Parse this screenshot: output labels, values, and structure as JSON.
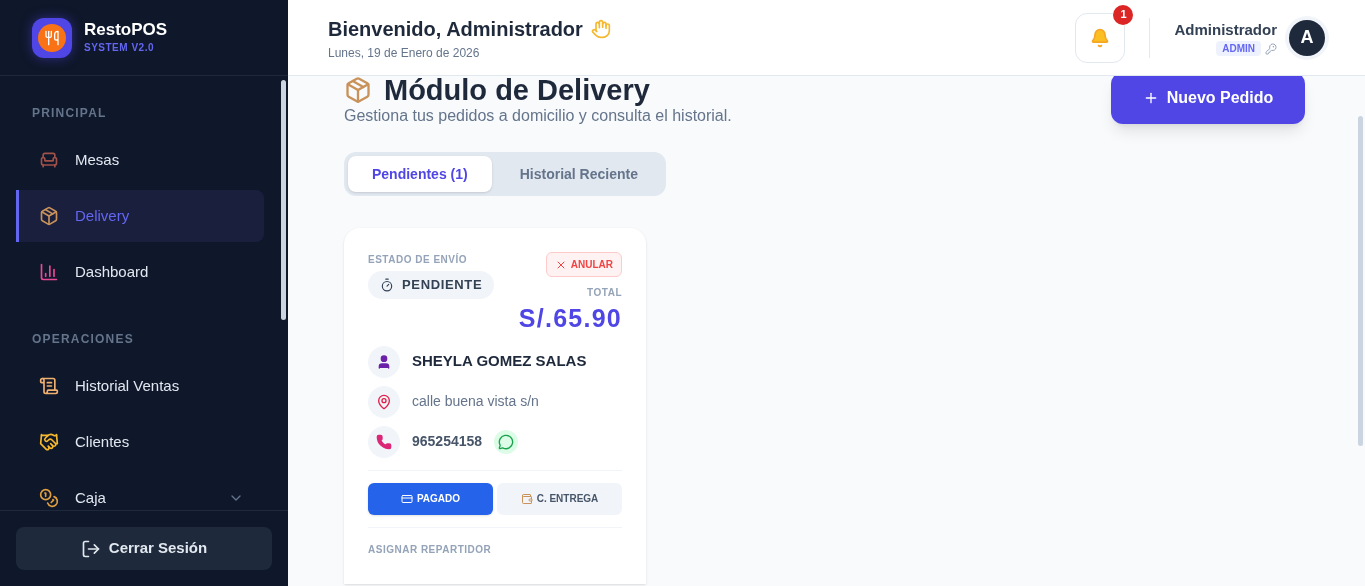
{
  "brand": {
    "name": "RestoPOS",
    "version": "SYSTEM V2.0"
  },
  "sidebar": {
    "sections": [
      {
        "title": "PRINCIPAL",
        "items": [
          {
            "label": "Mesas",
            "kind": "chair",
            "selected": false
          },
          {
            "label": "Delivery",
            "kind": "package",
            "selected": true
          },
          {
            "label": "Dashboard",
            "kind": "chart",
            "selected": false
          }
        ]
      },
      {
        "title": "OPERACIONES",
        "items": [
          {
            "label": "Historial Ventas",
            "kind": "scroll",
            "selected": false
          },
          {
            "label": "Clientes",
            "kind": "handshake",
            "selected": false
          },
          {
            "label": "Caja",
            "kind": "money",
            "selected": false,
            "expandable": true
          }
        ]
      }
    ],
    "logout": "Cerrar Sesión"
  },
  "header": {
    "greeting": "Bienvenido, Administrador",
    "date": "Lunes, 19 de Enero de 2026",
    "notifications": "1",
    "user": {
      "name": "Administrador",
      "role": "ADMIN",
      "initial": "A"
    }
  },
  "page": {
    "title": "Módulo de Delivery",
    "subtitle": "Gestiona tus pedidos a domicilio y consulta el historial.",
    "new_button": "Nuevo Pedido",
    "tabs": [
      {
        "label": "Pendientes (1)",
        "selected": true
      },
      {
        "label": "Historial Reciente",
        "selected": false
      }
    ]
  },
  "orders": [
    {
      "status_label": "ESTADO DE ENVÍO",
      "status": "PENDIENTE",
      "cancel": "ANULAR",
      "total_label": "TOTAL",
      "total": "S/.65.90",
      "customer": "SHEYLA GOMEZ SALAS",
      "address": "calle buena vista s/n",
      "phone": "965254158",
      "payments": [
        {
          "label": "PAGADO",
          "kind": "card",
          "selected": true
        },
        {
          "label": "C. ENTREGA",
          "kind": "cash",
          "selected": false
        }
      ],
      "assign_label": "ASIGNAR REPARTIDOR"
    }
  ]
}
